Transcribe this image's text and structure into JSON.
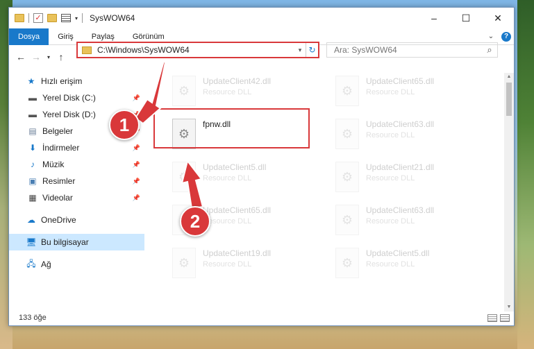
{
  "window": {
    "title": "SysWOW64",
    "controls": {
      "minimize": "–",
      "maximize": "☐",
      "close": "✕"
    }
  },
  "ribbon": {
    "tabs": [
      "Dosya",
      "Giriş",
      "Paylaş",
      "Görünüm"
    ],
    "active_tab": "Dosya"
  },
  "address_bar": {
    "path": "C:\\Windows\\SysWOW64"
  },
  "search": {
    "placeholder": "Ara: SysWOW64"
  },
  "sidebar": {
    "items": [
      {
        "label": "Hızlı erişim",
        "icon": "star-icon",
        "pinned": false
      },
      {
        "label": "Yerel Disk (C:)",
        "icon": "drive-icon",
        "pinned": true
      },
      {
        "label": "Yerel Disk (D:)",
        "icon": "drive-icon",
        "pinned": true
      },
      {
        "label": "Belgeler",
        "icon": "documents-icon",
        "pinned": true
      },
      {
        "label": "İndirmeler",
        "icon": "download-icon",
        "pinned": true
      },
      {
        "label": "Müzik",
        "icon": "music-icon",
        "pinned": true
      },
      {
        "label": "Resimler",
        "icon": "pictures-icon",
        "pinned": true
      },
      {
        "label": "Videolar",
        "icon": "video-icon",
        "pinned": true
      },
      {
        "label": "OneDrive",
        "icon": "cloud-icon",
        "pinned": false
      },
      {
        "label": "Bu bilgisayar",
        "icon": "computer-icon",
        "pinned": false,
        "selected": true
      },
      {
        "label": "Ağ",
        "icon": "network-icon",
        "pinned": false
      }
    ]
  },
  "files": {
    "highlighted": {
      "name": "fpnw.dll",
      "description": ""
    },
    "background": [
      {
        "name": "UpdateClient42.dll",
        "description": "Resource DLL"
      },
      {
        "name": "UpdateClient65.dll",
        "description": "Resource DLL"
      },
      {
        "name": "UpdateClient63.dll",
        "description": "Resource DLL"
      },
      {
        "name": "UpdateClient5.dll",
        "description": "Resource DLL"
      },
      {
        "name": "UpdateClient21.dll",
        "description": "Resource DLL"
      },
      {
        "name": "UpdateClient65.dll",
        "description": "Resource DLL"
      },
      {
        "name": "UpdateClient63.dll",
        "description": "Resource DLL"
      },
      {
        "name": "UpdateClient19.dll",
        "description": "Resource DLL"
      },
      {
        "name": "UpdateClient5.dll",
        "description": "Resource DLL"
      }
    ]
  },
  "status_bar": {
    "item_count": "133 öğe"
  },
  "annotations": {
    "step1": "1",
    "step2": "2",
    "highlight_color": "#d9383a"
  }
}
